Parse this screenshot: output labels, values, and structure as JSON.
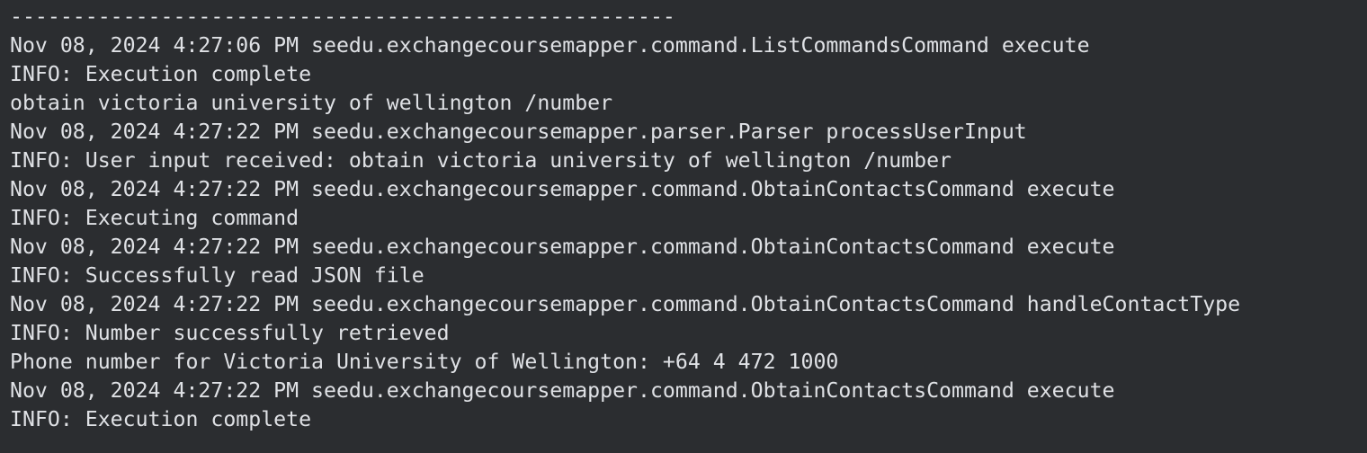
{
  "console": {
    "lines": [
      "-----------------------------------------------------",
      "Nov 08, 2024 4:27:06 PM seedu.exchangecoursemapper.command.ListCommandsCommand execute",
      "INFO: Execution complete",
      "obtain victoria university of wellington /number",
      "Nov 08, 2024 4:27:22 PM seedu.exchangecoursemapper.parser.Parser processUserInput",
      "INFO: User input received: obtain victoria university of wellington /number",
      "Nov 08, 2024 4:27:22 PM seedu.exchangecoursemapper.command.ObtainContactsCommand execute",
      "INFO: Executing command",
      "Nov 08, 2024 4:27:22 PM seedu.exchangecoursemapper.command.ObtainContactsCommand execute",
      "INFO: Successfully read JSON file",
      "Nov 08, 2024 4:27:22 PM seedu.exchangecoursemapper.command.ObtainContactsCommand handleContactType",
      "INFO: Number successfully retrieved",
      "Phone number for Victoria University of Wellington: +64 4 472 1000",
      "Nov 08, 2024 4:27:22 PM seedu.exchangecoursemapper.command.ObtainContactsCommand execute",
      "INFO: Execution complete"
    ]
  },
  "colors": {
    "background": "#2b2d30",
    "text": "#dfe1e5"
  }
}
